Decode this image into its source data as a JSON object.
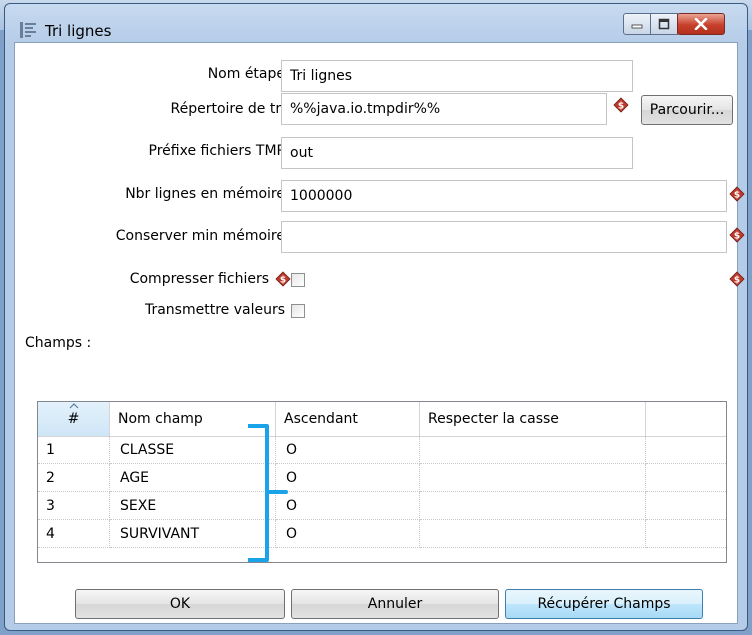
{
  "window": {
    "title": "Tri lignes"
  },
  "form": {
    "step_name": {
      "label": "Nom étape",
      "value": "Tri lignes"
    },
    "sort_dir": {
      "label": "Répertoire de tri",
      "value": "%%java.io.tmpdir%%",
      "browse_label": "Parcourir..."
    },
    "tmp_prefix": {
      "label": "Préfixe fichiers TMP",
      "value": "out"
    },
    "rows_in_memory": {
      "label": "Nbr lignes en mémoire",
      "value": "1000000"
    },
    "keep_min_memory": {
      "label": "Conserver min mémoire",
      "value": ""
    },
    "compress_files": {
      "label": "Compresser fichiers",
      "checked": false
    },
    "pass_values": {
      "label": "Transmettre valeurs",
      "checked": false
    }
  },
  "fields": {
    "label": "Champs :",
    "columns": [
      "#",
      "Nom champ",
      "Ascendant",
      "Respecter la casse"
    ],
    "rows": [
      {
        "num": "1",
        "name": "CLASSE",
        "asc": "O",
        "case": ""
      },
      {
        "num": "2",
        "name": "AGE",
        "asc": "O",
        "case": ""
      },
      {
        "num": "3",
        "name": "SEXE",
        "asc": "O",
        "case": ""
      },
      {
        "num": "4",
        "name": "SURVIVANT",
        "asc": "O",
        "case": ""
      }
    ]
  },
  "buttons": {
    "ok": "OK",
    "cancel": "Annuler",
    "get_fields": "Récupérer Champs"
  },
  "colors": {
    "annotation_bracket": "#1aa3e8",
    "variable_icon": "#c0392b"
  }
}
